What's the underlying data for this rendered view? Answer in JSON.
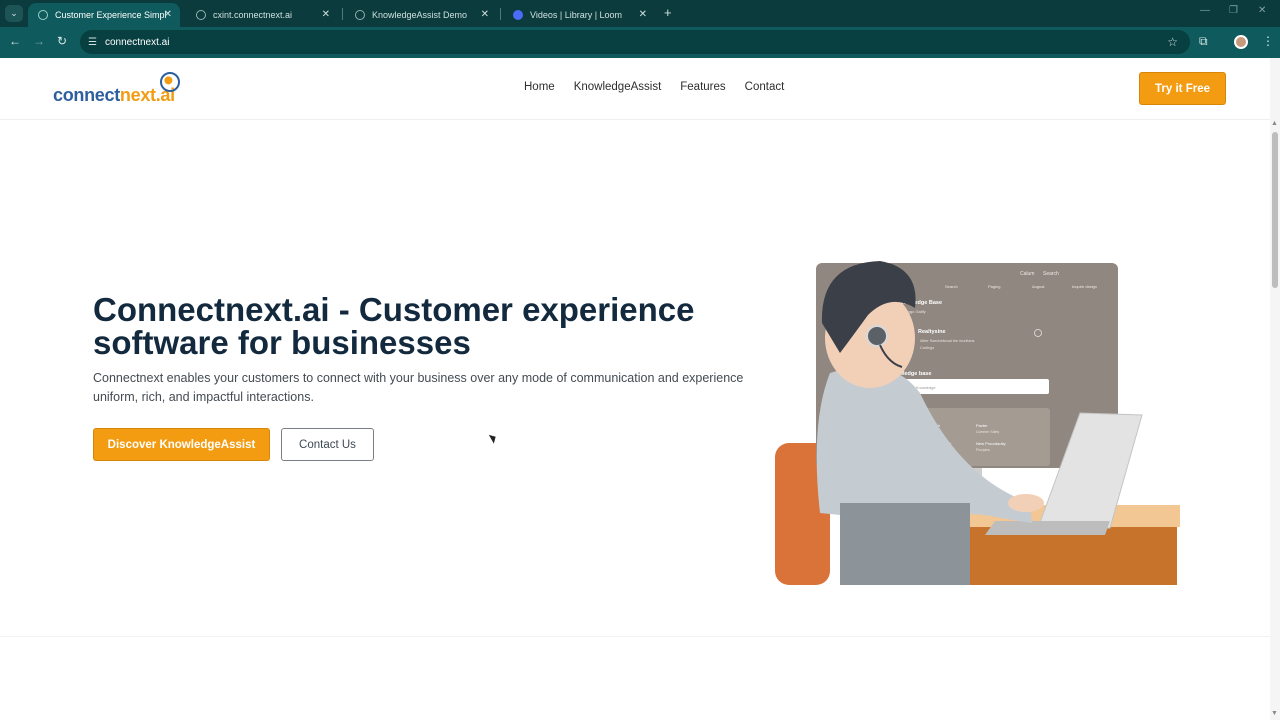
{
  "browser": {
    "tabs": [
      {
        "title": "Customer Experience Simplified",
        "active": true
      },
      {
        "title": "cxint.connectnext.ai",
        "active": false
      },
      {
        "title": "KnowledgeAssist Demo",
        "active": false
      },
      {
        "title": "Videos | Library | Loom",
        "active": false
      }
    ],
    "url": "connectnext.ai"
  },
  "header": {
    "logo": {
      "part1": "connect",
      "part2": "next.ai"
    },
    "nav": [
      "Home",
      "KnowledgeAssist",
      "Features",
      "Contact"
    ],
    "cta": "Try it Free"
  },
  "hero": {
    "title": "Connectnext.ai - Customer experience software for businesses",
    "subtitle": "Connectnext enables your customers to connect with your business over any mode of communication and experience uniform, rich, and impactful interactions.",
    "primary_button": "Discover KnowledgeAssist",
    "secondary_button": "Contact Us"
  },
  "illustration_screen": {
    "top_labels": [
      "Calum",
      "Search"
    ],
    "tabs": [
      "Search",
      "Paging",
      "August",
      "Inquire design"
    ],
    "section1": "Knowledge Base",
    "section1_sub": "Aggo Gallfy",
    "item1_title": "Realtysine",
    "item1_sub": "Allter Ssenbetional the munitans",
    "item1_sub2": "Cartings",
    "section2": "Knowledge base",
    "search_placeholder": "Search Knowledge",
    "section3": "Publhsign asence",
    "row1_left": "Seontle Dolosch",
    "row1_left_sub": "Testing correct",
    "row1_right": "Pazter",
    "row1_right_sub": "Commer Sdley",
    "row2_left": "Ssontle Buse anterpay",
    "row2_left_sub": "Testing resdert",
    "row2_right": "New Proordaoity",
    "row2_right_sub": "Pincipiss"
  },
  "colors": {
    "brand_orange": "#f39c12",
    "brand_blue": "#2d5f9e",
    "title_navy": "#132a3e",
    "chrome_teal": "#0e5a5c"
  }
}
